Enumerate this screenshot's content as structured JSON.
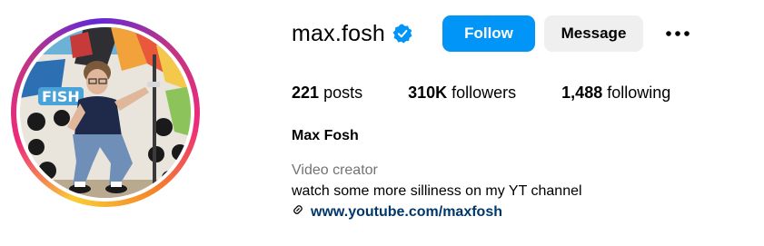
{
  "profile": {
    "username": "max.fosh",
    "full_name": "Max Fosh",
    "category": "Video creator",
    "bio": "watch some more silliness on my YT channel",
    "link": "www.youtube.com/maxfosh"
  },
  "buttons": {
    "follow": "Follow",
    "message": "Message"
  },
  "stats": {
    "posts_count": "221",
    "posts_label": "posts",
    "followers_count": "310K",
    "followers_label": "followers",
    "following_count": "1,488",
    "following_label": "following"
  },
  "icons": {
    "verified": "verified-badge-icon",
    "more": "more-options-icon",
    "link": "link-icon"
  },
  "colors": {
    "follow_button": "#0095f6",
    "message_button": "#efefef",
    "verified_badge": "#0095f6",
    "link_text": "#00376b",
    "category_text": "#737373"
  }
}
